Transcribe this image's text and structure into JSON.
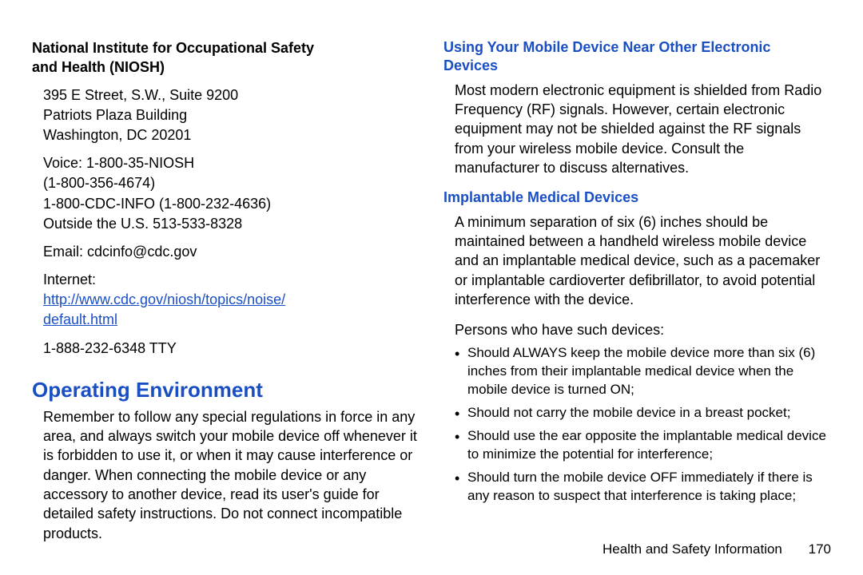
{
  "left": {
    "org_heading_l1": "National Institute for Occupational Safety",
    "org_heading_l2": "and Health (NIOSH)",
    "addr1": "395 E Street, S.W., Suite 9200",
    "addr2": "Patriots Plaza Building",
    "addr3": "Washington, DC 20201",
    "voice1": "Voice: 1-800-35-NIOSH",
    "voice2": "(1-800-356-4674)",
    "voice3": "1-800-CDC-INFO (1-800-232-4636)",
    "voice4": "Outside the U.S. 513-533-8328",
    "email": "Email: cdcinfo@cdc.gov",
    "internet_label": "Internet:",
    "internet_url_l1": "http://www.cdc.gov/niosh/topics/noise/",
    "internet_url_l2": "default.html",
    "tty": "1-888-232-6348 TTY",
    "h1": "Operating Environment",
    "para": "Remember to follow any special regulations in force in any area, and always switch your mobile device off whenever it is forbidden to use it, or when it may cause interference or danger. When connecting the mobile device or any accessory to another device, read its user's guide for detailed safety instructions. Do not connect incompatible products."
  },
  "right": {
    "h2a_l1": "Using Your Mobile Device Near Other Electronic",
    "h2a_l2": "Devices",
    "para_a": "Most modern electronic equipment is shielded from Radio Frequency (RF) signals. However, certain electronic equipment may not be shielded against the RF signals from your wireless mobile device. Consult the manufacturer to discuss alternatives.",
    "h2b": "Implantable Medical Devices",
    "para_b": "A minimum separation of six (6) inches should be maintained between a handheld wireless mobile device and an implantable medical device, such as a pacemaker or implantable cardioverter defibrillator, to avoid potential interference with the device.",
    "para_c": "Persons who have such devices:",
    "bullets": [
      "Should ALWAYS keep the mobile device more than six (6) inches from their implantable medical device when the mobile device is turned ON;",
      "Should not carry the mobile device in a breast pocket;",
      "Should use the ear opposite the implantable medical device to minimize the potential for interference;",
      "Should turn the mobile device OFF immediately if there is any reason to suspect that interference is taking place;"
    ]
  },
  "footer": {
    "section": "Health and Safety Information",
    "page": "170"
  }
}
